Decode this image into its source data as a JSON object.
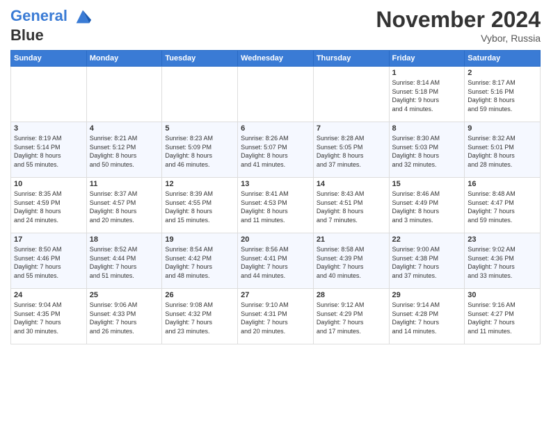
{
  "logo": {
    "line1": "General",
    "line2": "Blue"
  },
  "title": "November 2024",
  "location": "Vybor, Russia",
  "days_header": [
    "Sunday",
    "Monday",
    "Tuesday",
    "Wednesday",
    "Thursday",
    "Friday",
    "Saturday"
  ],
  "weeks": [
    [
      {
        "day": "",
        "info": ""
      },
      {
        "day": "",
        "info": ""
      },
      {
        "day": "",
        "info": ""
      },
      {
        "day": "",
        "info": ""
      },
      {
        "day": "",
        "info": ""
      },
      {
        "day": "1",
        "info": "Sunrise: 8:14 AM\nSunset: 5:18 PM\nDaylight: 9 hours\nand 4 minutes."
      },
      {
        "day": "2",
        "info": "Sunrise: 8:17 AM\nSunset: 5:16 PM\nDaylight: 8 hours\nand 59 minutes."
      }
    ],
    [
      {
        "day": "3",
        "info": "Sunrise: 8:19 AM\nSunset: 5:14 PM\nDaylight: 8 hours\nand 55 minutes."
      },
      {
        "day": "4",
        "info": "Sunrise: 8:21 AM\nSunset: 5:12 PM\nDaylight: 8 hours\nand 50 minutes."
      },
      {
        "day": "5",
        "info": "Sunrise: 8:23 AM\nSunset: 5:09 PM\nDaylight: 8 hours\nand 46 minutes."
      },
      {
        "day": "6",
        "info": "Sunrise: 8:26 AM\nSunset: 5:07 PM\nDaylight: 8 hours\nand 41 minutes."
      },
      {
        "day": "7",
        "info": "Sunrise: 8:28 AM\nSunset: 5:05 PM\nDaylight: 8 hours\nand 37 minutes."
      },
      {
        "day": "8",
        "info": "Sunrise: 8:30 AM\nSunset: 5:03 PM\nDaylight: 8 hours\nand 32 minutes."
      },
      {
        "day": "9",
        "info": "Sunrise: 8:32 AM\nSunset: 5:01 PM\nDaylight: 8 hours\nand 28 minutes."
      }
    ],
    [
      {
        "day": "10",
        "info": "Sunrise: 8:35 AM\nSunset: 4:59 PM\nDaylight: 8 hours\nand 24 minutes."
      },
      {
        "day": "11",
        "info": "Sunrise: 8:37 AM\nSunset: 4:57 PM\nDaylight: 8 hours\nand 20 minutes."
      },
      {
        "day": "12",
        "info": "Sunrise: 8:39 AM\nSunset: 4:55 PM\nDaylight: 8 hours\nand 15 minutes."
      },
      {
        "day": "13",
        "info": "Sunrise: 8:41 AM\nSunset: 4:53 PM\nDaylight: 8 hours\nand 11 minutes."
      },
      {
        "day": "14",
        "info": "Sunrise: 8:43 AM\nSunset: 4:51 PM\nDaylight: 8 hours\nand 7 minutes."
      },
      {
        "day": "15",
        "info": "Sunrise: 8:46 AM\nSunset: 4:49 PM\nDaylight: 8 hours\nand 3 minutes."
      },
      {
        "day": "16",
        "info": "Sunrise: 8:48 AM\nSunset: 4:47 PM\nDaylight: 7 hours\nand 59 minutes."
      }
    ],
    [
      {
        "day": "17",
        "info": "Sunrise: 8:50 AM\nSunset: 4:46 PM\nDaylight: 7 hours\nand 55 minutes."
      },
      {
        "day": "18",
        "info": "Sunrise: 8:52 AM\nSunset: 4:44 PM\nDaylight: 7 hours\nand 51 minutes."
      },
      {
        "day": "19",
        "info": "Sunrise: 8:54 AM\nSunset: 4:42 PM\nDaylight: 7 hours\nand 48 minutes."
      },
      {
        "day": "20",
        "info": "Sunrise: 8:56 AM\nSunset: 4:41 PM\nDaylight: 7 hours\nand 44 minutes."
      },
      {
        "day": "21",
        "info": "Sunrise: 8:58 AM\nSunset: 4:39 PM\nDaylight: 7 hours\nand 40 minutes."
      },
      {
        "day": "22",
        "info": "Sunrise: 9:00 AM\nSunset: 4:38 PM\nDaylight: 7 hours\nand 37 minutes."
      },
      {
        "day": "23",
        "info": "Sunrise: 9:02 AM\nSunset: 4:36 PM\nDaylight: 7 hours\nand 33 minutes."
      }
    ],
    [
      {
        "day": "24",
        "info": "Sunrise: 9:04 AM\nSunset: 4:35 PM\nDaylight: 7 hours\nand 30 minutes."
      },
      {
        "day": "25",
        "info": "Sunrise: 9:06 AM\nSunset: 4:33 PM\nDaylight: 7 hours\nand 26 minutes."
      },
      {
        "day": "26",
        "info": "Sunrise: 9:08 AM\nSunset: 4:32 PM\nDaylight: 7 hours\nand 23 minutes."
      },
      {
        "day": "27",
        "info": "Sunrise: 9:10 AM\nSunset: 4:31 PM\nDaylight: 7 hours\nand 20 minutes."
      },
      {
        "day": "28",
        "info": "Sunrise: 9:12 AM\nSunset: 4:29 PM\nDaylight: 7 hours\nand 17 minutes."
      },
      {
        "day": "29",
        "info": "Sunrise: 9:14 AM\nSunset: 4:28 PM\nDaylight: 7 hours\nand 14 minutes."
      },
      {
        "day": "30",
        "info": "Sunrise: 9:16 AM\nSunset: 4:27 PM\nDaylight: 7 hours\nand 11 minutes."
      }
    ]
  ]
}
